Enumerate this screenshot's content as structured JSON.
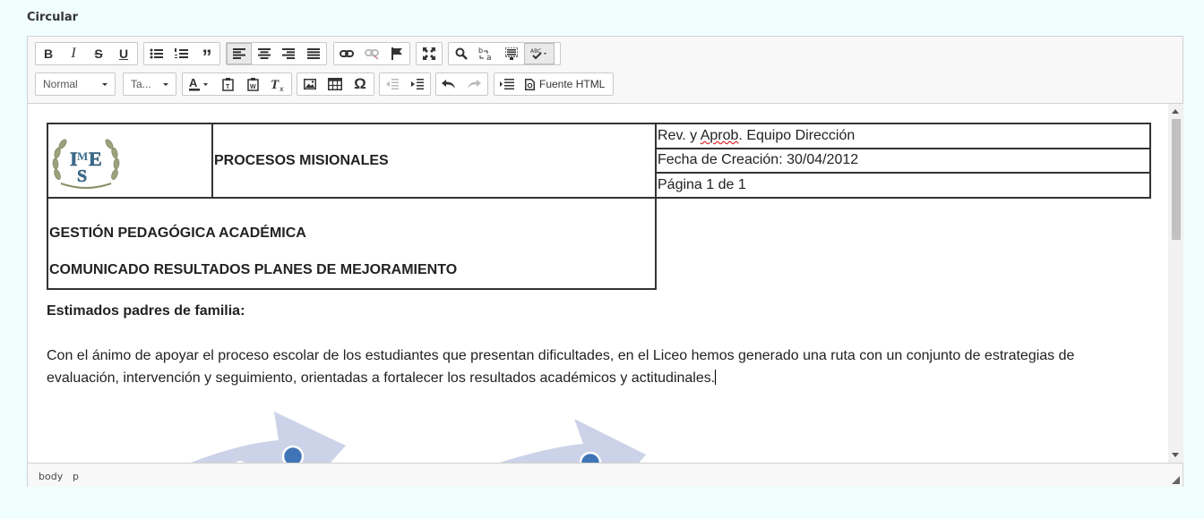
{
  "field_label": "Circular",
  "toolbar": {
    "format_combo": "Normal",
    "size_combo": "Ta...",
    "source_label": "Fuente HTML"
  },
  "header_table": {
    "title": "PROCESOS  MISIONALES",
    "rev_prefix": "Rev. y ",
    "rev_word": "Aprob",
    "rev_suffix": ". Equipo  Dirección",
    "created": "Fecha de Creación: 30/04/2012",
    "page": "Página 1 de 1",
    "dept": "GESTIÓN PEDAGÓGICA ACADÉMICA",
    "subject": "COMUNICADO RESULTADOS PLANES DE MEJORAMIENTO",
    "logo_letters": "IMSE"
  },
  "greeting": "Estimados padres de familia:",
  "paragraph": "Con el ánimo de apoyar el proceso escolar de los estudiantes que presentan dificultades, en el Liceo hemos generado una ruta con un conjunto de estrategias de evaluación, intervención y seguimiento, orientadas a fortalecer los resultados académicos y actitudinales.",
  "statusbar": {
    "path_body": "body",
    "path_p": "p"
  }
}
